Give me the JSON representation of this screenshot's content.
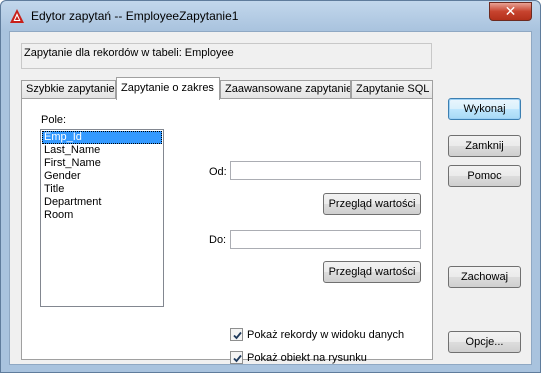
{
  "window": {
    "title": "Edytor zapytań -- EmployeeZapytanie1",
    "close_label": "✕",
    "app_icon": "autocad-icon",
    "accent_color": "#c7432e"
  },
  "info": {
    "text": "Zapytanie dla rekordów w tabeli:  Employee"
  },
  "tabs": [
    {
      "label": "Szybkie zapytanie"
    },
    {
      "label": "Zapytanie o zakres"
    },
    {
      "label": "Zaawansowane zapytanie"
    },
    {
      "label": "Zapytanie SQL"
    }
  ],
  "panel": {
    "field_label": "Pole:",
    "fields": [
      "Emp_Id",
      "Last_Name",
      "First_Name",
      "Gender",
      "Title",
      "Department",
      "Room"
    ],
    "selected_field": "Emp_Id",
    "from_label": "Od:",
    "from_value": "",
    "to_label": "Do:",
    "to_value": "",
    "browse_label_1": "Przegląd wartości",
    "browse_label_2": "Przegląd wartości",
    "show_records_label": "Pokaż rekordy w widoku danych",
    "show_records_checked": true,
    "show_object_label": "Pokaż obiekt na rysunku",
    "show_object_checked": true
  },
  "side_buttons": {
    "execute": "Wykonaj",
    "close": "Zamknij",
    "help": "Pomoc",
    "save": "Zachowaj",
    "options": "Opcje..."
  }
}
